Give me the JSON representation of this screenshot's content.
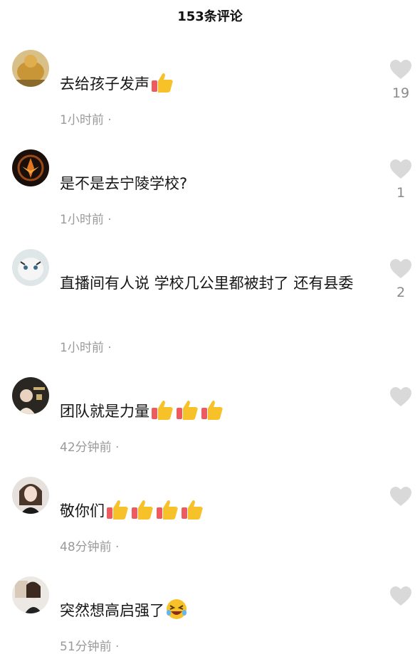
{
  "header": {
    "title": "153条评论"
  },
  "comments": [
    {
      "text": "去给孩子发声",
      "time": "1小时前",
      "dot": "·",
      "likes": "19",
      "emoji": [
        "thumbs-up"
      ]
    },
    {
      "text": "是不是去宁陵学校?",
      "time": "1小时前",
      "dot": "·",
      "likes": "1",
      "emoji": []
    },
    {
      "text": "直播间有人说  学校几公里都被封了  还有县委",
      "time": "1小时前",
      "dot": "·",
      "likes": "2",
      "emoji": []
    },
    {
      "text": "团队就是力量",
      "time": "42分钟前",
      "dot": "·",
      "likes": "",
      "emoji": [
        "thumbs-up",
        "thumbs-up",
        "thumbs-up"
      ]
    },
    {
      "text": "敬你们",
      "time": "48分钟前",
      "dot": "·",
      "likes": "",
      "emoji": [
        "thumbs-up",
        "thumbs-up",
        "thumbs-up",
        "thumbs-up"
      ]
    },
    {
      "text": "突然想高启强了",
      "time": "51分钟前",
      "dot": "·",
      "likes": "",
      "emoji": [
        "rolling-laughing"
      ]
    }
  ],
  "colors": {
    "heart": "#d9d9d9",
    "meta": "#9a9a9a",
    "text": "#161616"
  }
}
